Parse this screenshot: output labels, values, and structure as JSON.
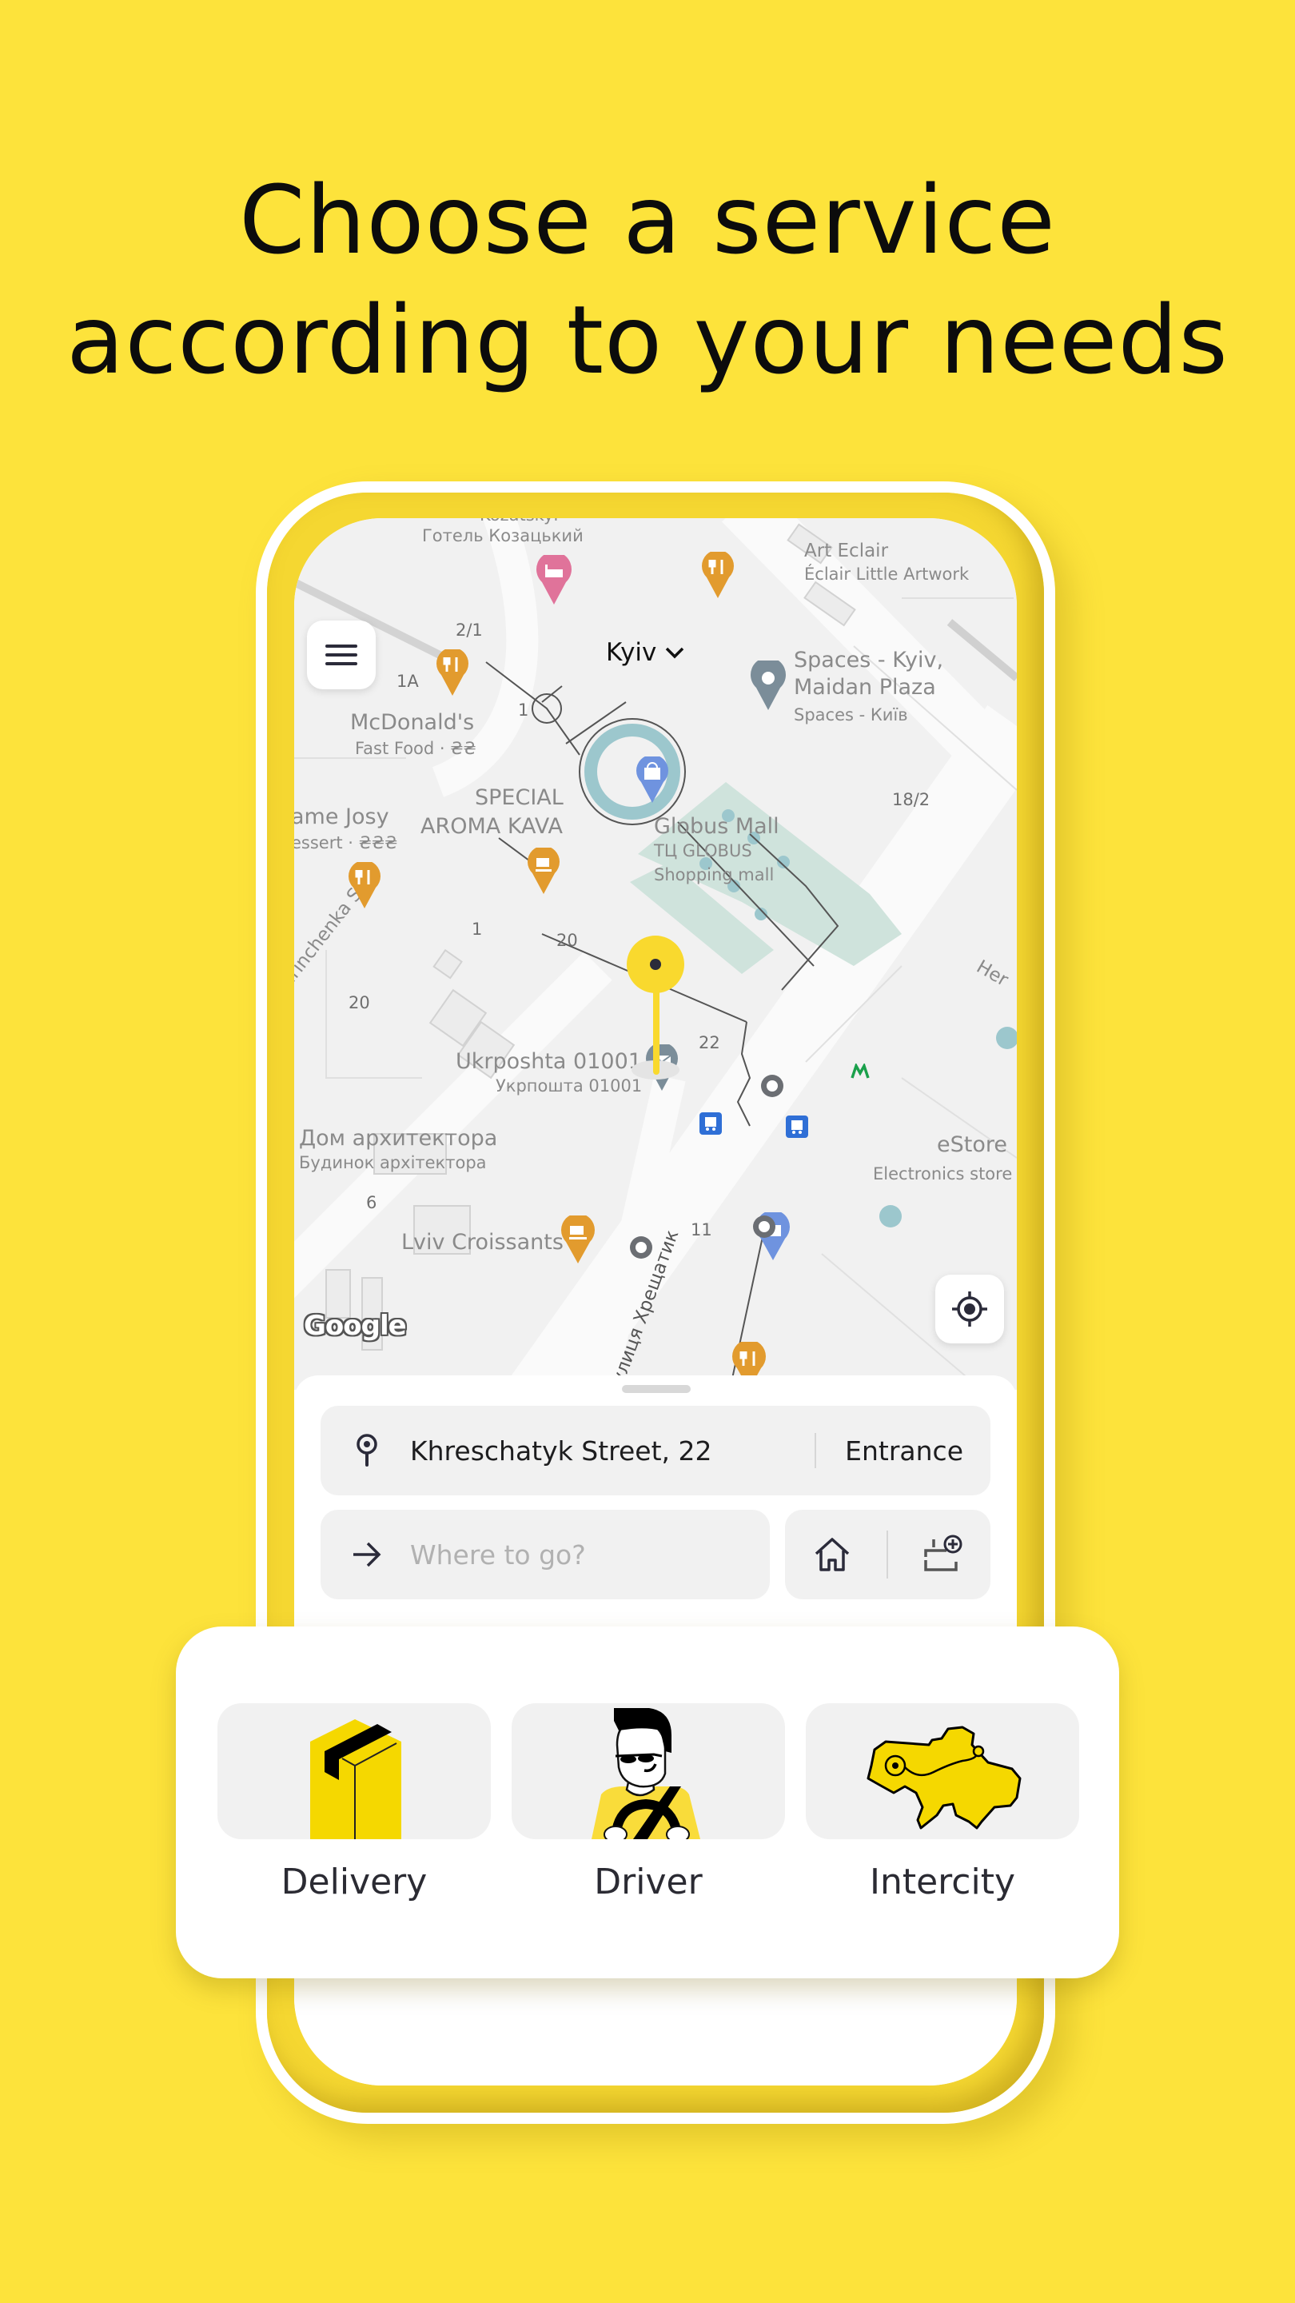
{
  "headline": {
    "line1": "Choose a service",
    "line2": "according to your needs"
  },
  "colors": {
    "background": "#fde33b",
    "accent_yellow": "#f5d800",
    "poi_food": "#e29b2e",
    "poi_hotel": "#e0739a",
    "poi_shop": "#6f93df",
    "poi_generic": "#7b8d99",
    "transit_bus": "#2f6fd6",
    "metro": "#1aa04b"
  },
  "map": {
    "city_selector": {
      "label": "Kyiv",
      "icon": "chevron-down-icon"
    },
    "menu_button": {
      "icon": "hamburger-menu-icon"
    },
    "locate_button": {
      "icon": "my-location-icon"
    },
    "attribution": "Google",
    "labels": [
      {
        "id": "kozatskyi-top",
        "text": "Kozatskyi"
      },
      {
        "id": "kozatskyi",
        "text": "Готель Козацький"
      },
      {
        "id": "art-eclair",
        "text": "Art Eclair"
      },
      {
        "id": "art-eclair-sub",
        "text": "Éclair Little Artwork"
      },
      {
        "id": "num-2-1",
        "text": "2/1"
      },
      {
        "id": "num-1a",
        "text": "1A"
      },
      {
        "id": "num-1",
        "text": "1"
      },
      {
        "id": "mcdonalds",
        "text": "McDonald's"
      },
      {
        "id": "mcdonalds-sub",
        "text": "Fast Food · ₴₴"
      },
      {
        "id": "spaces",
        "text": "Spaces - Kyiv,"
      },
      {
        "id": "spaces-2",
        "text": "Maidan Plaza"
      },
      {
        "id": "spaces-sub",
        "text": "Spaces - Київ"
      },
      {
        "id": "num-18-2",
        "text": "18/2"
      },
      {
        "id": "madame-josy",
        "text": "ame Josy"
      },
      {
        "id": "madame-josy-sub",
        "text": "essert · ₴₴₴"
      },
      {
        "id": "special",
        "text": "SPECIAL"
      },
      {
        "id": "aroma-kava",
        "text": "AROMA KAVA"
      },
      {
        "id": "globus",
        "text": "Globus Mall"
      },
      {
        "id": "globus-ua",
        "text": "ТЦ GLOBUS"
      },
      {
        "id": "globus-sub",
        "text": "Shopping mall"
      },
      {
        "id": "hrinchenka",
        "text": "Hrinchenka St"
      },
      {
        "id": "num-1b",
        "text": "1"
      },
      {
        "id": "num-20a",
        "text": "20"
      },
      {
        "id": "num-20b",
        "text": "20"
      },
      {
        "id": "hers",
        "text": "Her"
      },
      {
        "id": "num-22",
        "text": "22"
      },
      {
        "id": "ukrposhta",
        "text": "Ukrposhta 01001"
      },
      {
        "id": "ukrposhta-ua",
        "text": "Укрпошта 01001"
      },
      {
        "id": "dom-arch",
        "text": "Дом архитектора"
      },
      {
        "id": "dom-arch-ua",
        "text": "Будинок архітектора"
      },
      {
        "id": "estore",
        "text": "eStore"
      },
      {
        "id": "estore-sub",
        "text": "Electronics store"
      },
      {
        "id": "num-6",
        "text": "6"
      },
      {
        "id": "lviv-croissants",
        "text": "Lviv Croissants"
      },
      {
        "id": "num-11",
        "text": "11"
      },
      {
        "id": "khreshchatyk",
        "text": "вулиця Хрещатик"
      }
    ]
  },
  "booking": {
    "pickup": {
      "icon": "pickup-pin-icon",
      "value": "Khreschatyk Street, 22",
      "entrance_label": "Entrance"
    },
    "destination": {
      "icon": "arrow-right-icon",
      "placeholder": "Where to go?"
    },
    "shortcuts": [
      {
        "icon": "home-icon",
        "label": "Home"
      },
      {
        "icon": "add-address-icon",
        "label": "Add address"
      }
    ]
  },
  "services": [
    {
      "label": "Delivery",
      "icon": "delivery-box-icon"
    },
    {
      "label": "Driver",
      "icon": "driver-icon"
    },
    {
      "label": "Intercity",
      "icon": "ukraine-map-icon"
    }
  ]
}
